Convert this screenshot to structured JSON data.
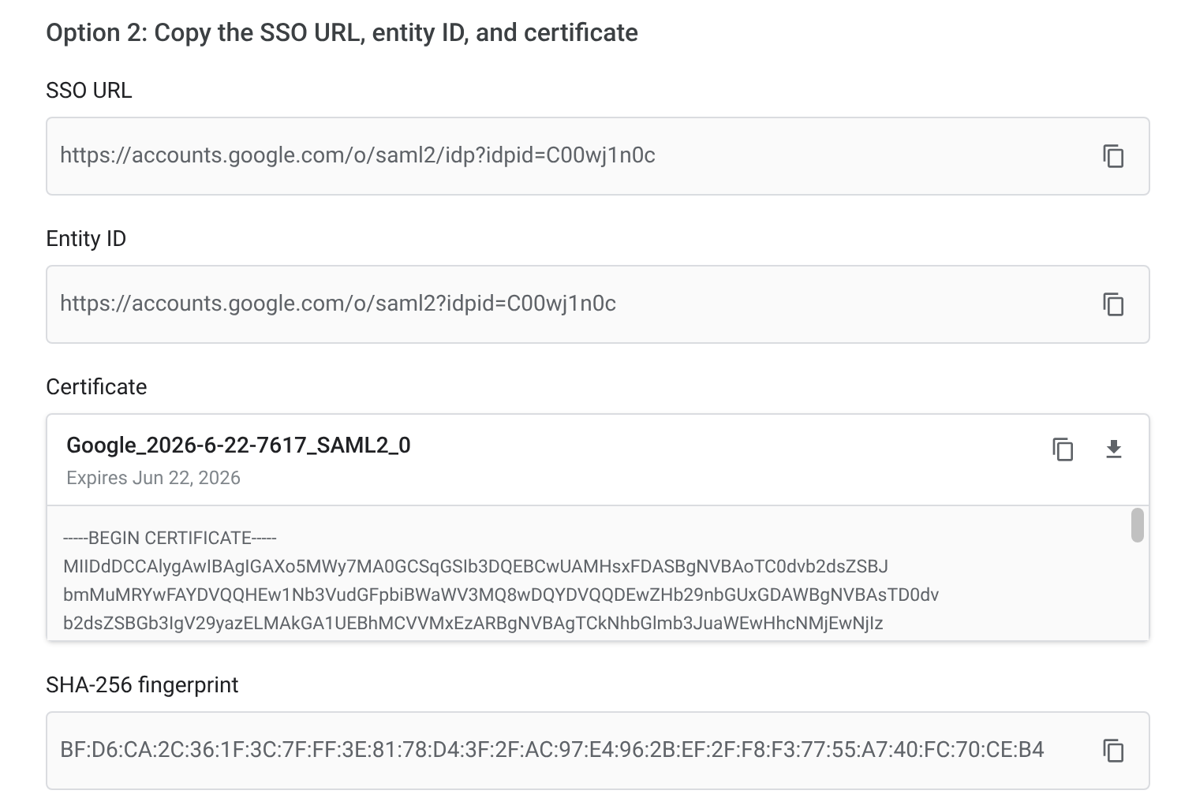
{
  "heading": "Option 2: Copy the SSO URL, entity ID, and certificate",
  "fields": [
    {
      "kind": "value",
      "label": "SSO URL",
      "value": "https://accounts.google.com/o/saml2/idp?idpid=C00wj1n0c"
    },
    {
      "kind": "value",
      "label": "Entity ID",
      "value": "https://accounts.google.com/o/saml2?idpid=C00wj1n0c"
    },
    {
      "kind": "certificate",
      "label": "Certificate",
      "name": "Google_2026-6-22-7617_SAML2_0",
      "expires": "Expires Jun 22, 2026",
      "lines": [
        "-----BEGIN CERTIFICATE-----",
        "MIIDdDCCAlygAwIBAgIGAXo5MWy7MA0GCSqGSIb3DQEBCwUAMHsxFDASBgNVBAoTC0dvb2dsZSBJ",
        "bmMuMRYwFAYDVQQHEw1Nb3VudGFpbiBWaWV3MQ8wDQYDVQQDEwZHb29nbGUxGDAWBgNVBAsTD0dv",
        "b2dsZSBGb3IgV29yazELMAkGA1UEBhMCVVMxEzARBgNVBAgTCkNhbGlmb3JuaWEwHhcNMjEwNjIz"
      ]
    },
    {
      "kind": "value",
      "label": "SHA-256 fingerprint",
      "value": "BF:D6:CA:2C:36:1F:3C:7F:FF:3E:81:78:D4:3F:2F:AC:97:E4:96:2B:EF:2F:F8:F3:77:55:A7:40:FC:70:CE:B4"
    }
  ]
}
